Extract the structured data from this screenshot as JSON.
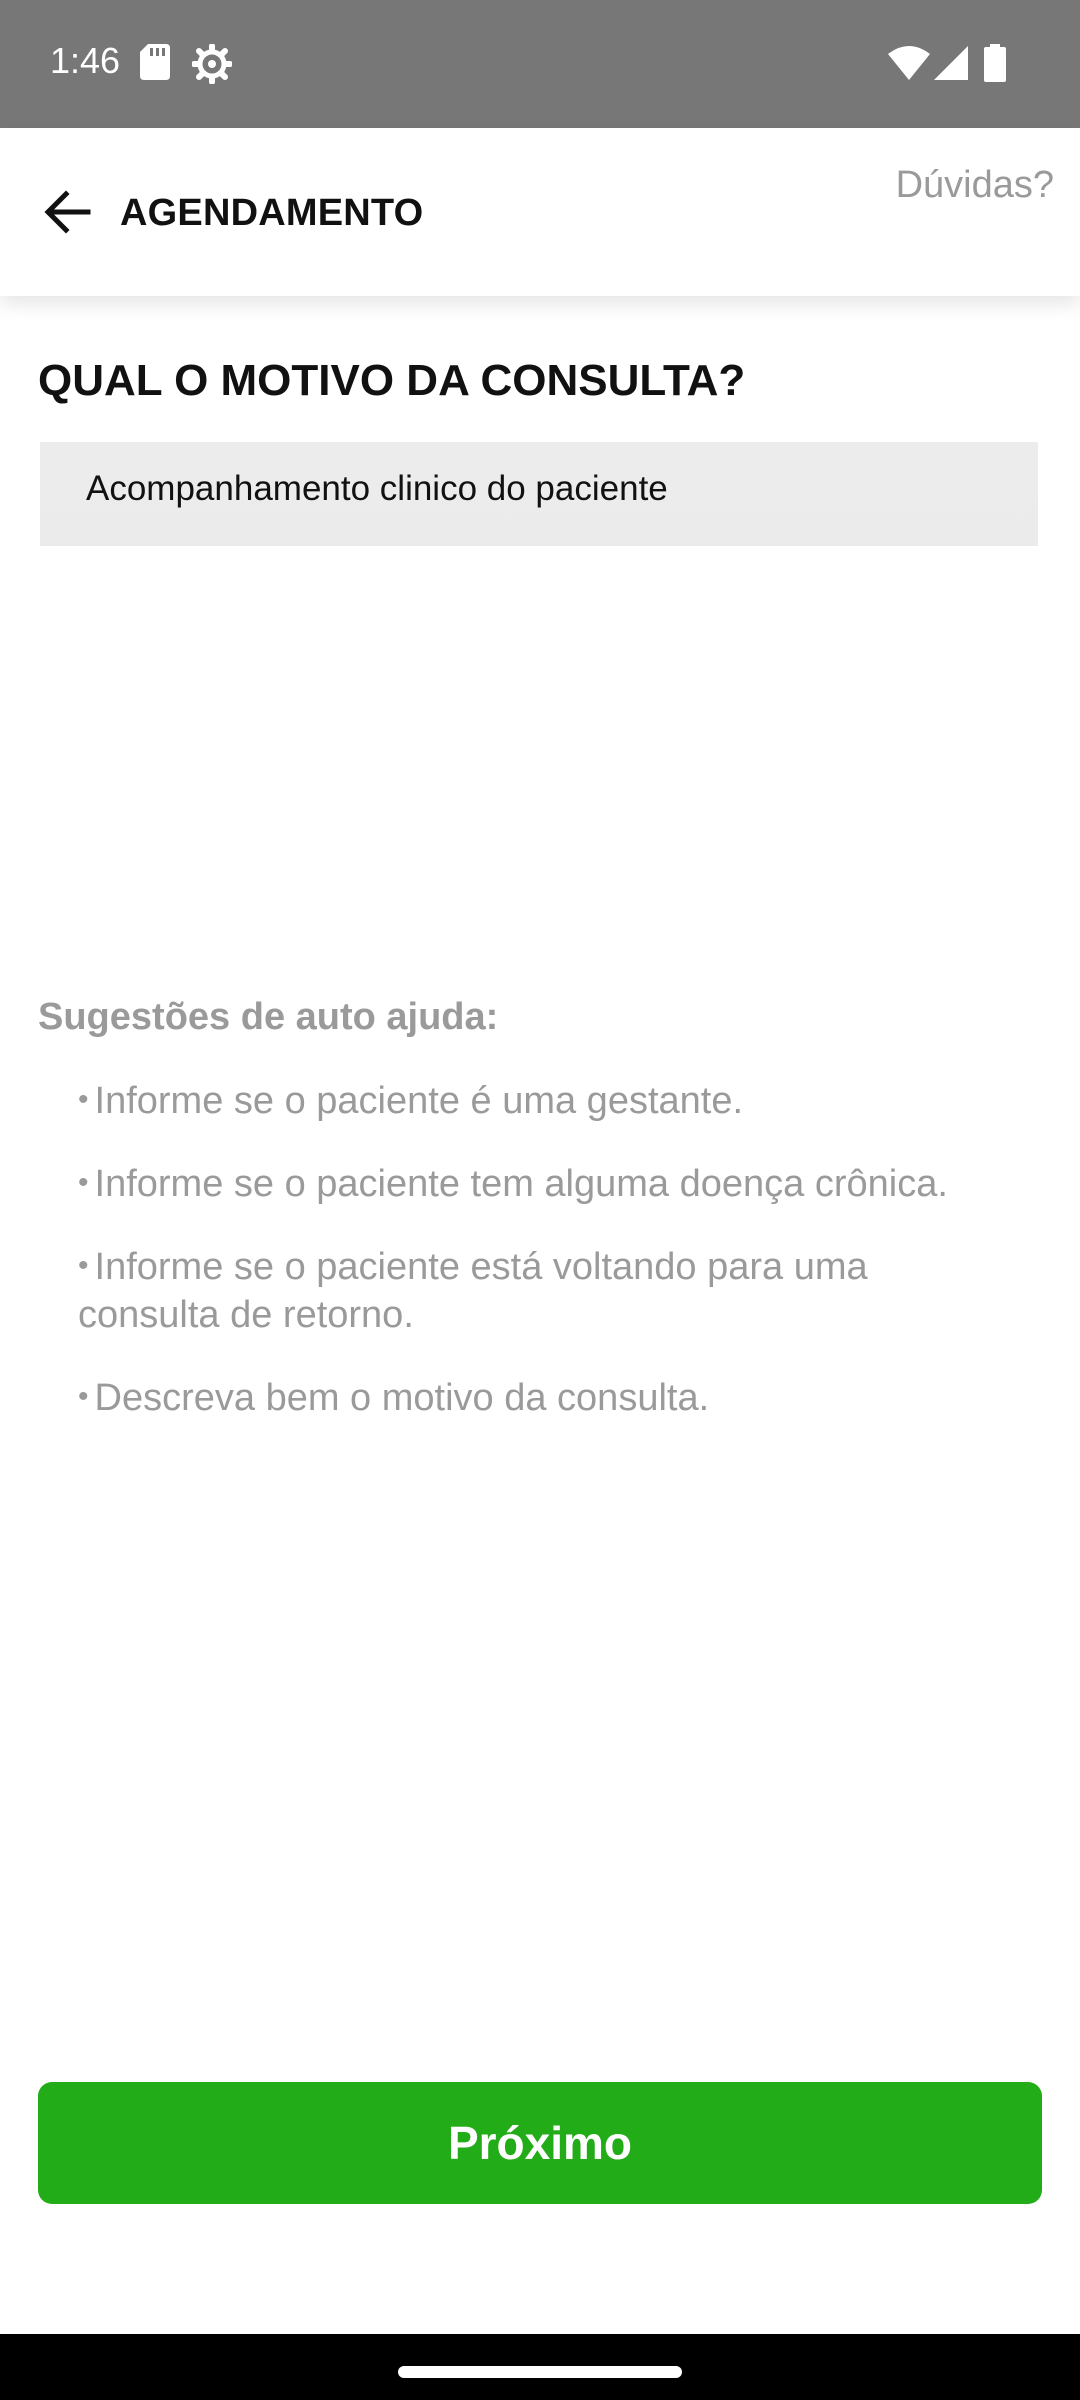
{
  "status_bar": {
    "time": "1:46",
    "icons": [
      "sd-card-icon",
      "settings-gear-icon",
      "wifi-icon",
      "signal-icon",
      "battery-icon"
    ]
  },
  "app_bar": {
    "back_icon": "arrow-left-icon",
    "title": "AGENDAMENTO",
    "help_label": "Dúvidas?"
  },
  "main": {
    "question": "QUAL O MOTIVO DA CONSULTA?",
    "reason_value": "Acompanhamento clinico do paciente",
    "suggestions_title": "Sugestões de auto ajuda:",
    "suggestions": [
      "Informe se o paciente é uma gestante.",
      "Informe se o paciente tem alguma doença crônica.",
      "Informe se o paciente está voltando para uma consulta de retorno.",
      "Descreva bem o motivo da consulta."
    ]
  },
  "footer": {
    "next_label": "Próximo"
  },
  "colors": {
    "status_bar": "#777777",
    "primary_green": "#22ac18",
    "muted_text": "#9a9a9a",
    "input_bg": "#f2f2f2"
  }
}
